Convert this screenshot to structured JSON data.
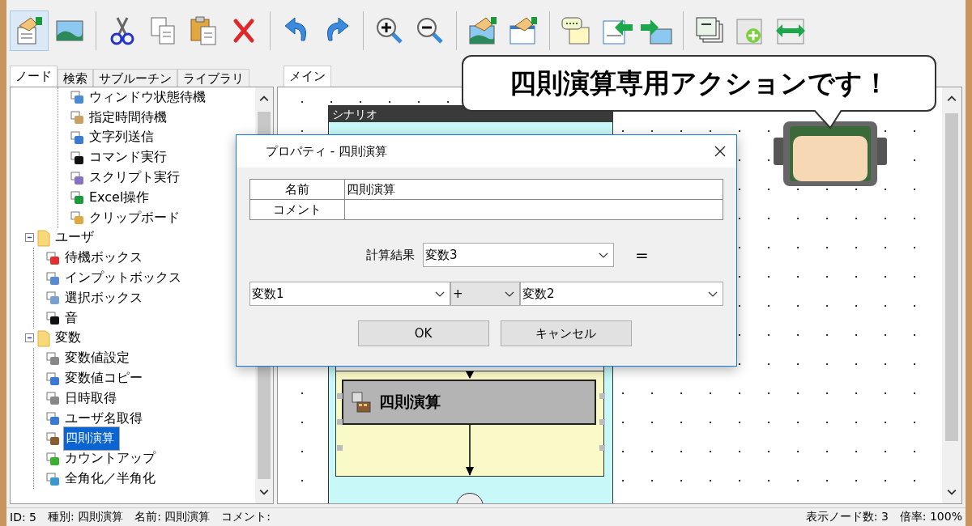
{
  "toolbar": [
    [
      {
        "selected": true
      },
      {
        "selected": false
      }
    ],
    [
      {
        "selected": false
      },
      {
        "selected": false
      },
      {
        "selected": false
      },
      {
        "selected": false
      }
    ],
    [
      {
        "selected": false
      },
      {
        "selected": false
      }
    ],
    [
      {
        "selected": false
      },
      {
        "selected": false
      }
    ],
    [
      {
        "selected": false
      },
      {
        "selected": false
      }
    ],
    [
      {
        "selected": false
      },
      {
        "selected": false
      },
      {
        "selected": false
      }
    ],
    [
      {
        "selected": false
      },
      {
        "selected": false
      },
      {
        "selected": false
      }
    ]
  ],
  "left_tabs": [
    {
      "label": "ノード",
      "selected": true
    },
    {
      "label": "検索",
      "selected": false
    },
    {
      "label": "サブルーチン",
      "selected": false
    },
    {
      "label": "ライブラリ",
      "selected": false
    }
  ],
  "tree": [
    {
      "kind": "hidden",
      "children": [
        {
          "kind": "item",
          "label": "ウィンドウ状態待機",
          "selected": false
        },
        {
          "kind": "item",
          "label": "指定時間待機",
          "selected": false
        },
        {
          "kind": "item",
          "label": "文字列送信",
          "selected": false
        },
        {
          "kind": "item",
          "label": "コマンド実行",
          "selected": false
        },
        {
          "kind": "item",
          "label": "スクリプト実行",
          "selected": false
        },
        {
          "kind": "item",
          "label": "Excel操作",
          "selected": false
        },
        {
          "kind": "item",
          "label": "クリップボード",
          "selected": false
        }
      ]
    },
    {
      "kind": "folder",
      "label": "ユーザ",
      "expanded": true,
      "selected": false,
      "children": [
        {
          "kind": "item",
          "label": "待機ボックス",
          "selected": false
        },
        {
          "kind": "item",
          "label": "インプットボックス",
          "selected": false
        },
        {
          "kind": "item",
          "label": "選択ボックス",
          "selected": false
        },
        {
          "kind": "item",
          "label": "音",
          "selected": false
        }
      ]
    },
    {
      "kind": "folder",
      "label": "変数",
      "expanded": true,
      "selected": false,
      "children": [
        {
          "kind": "item",
          "label": "変数値設定",
          "selected": false
        },
        {
          "kind": "item",
          "label": "変数値コピー",
          "selected": false
        },
        {
          "kind": "item",
          "label": "日時取得",
          "selected": false
        },
        {
          "kind": "item",
          "label": "ユーザ名取得",
          "selected": false
        },
        {
          "kind": "item",
          "label": "四則演算",
          "selected": true
        },
        {
          "kind": "item",
          "label": "カウントアップ",
          "selected": false
        },
        {
          "kind": "item",
          "label": "全角化／半角化",
          "selected": false
        }
      ]
    }
  ],
  "canvas_tabs": [
    {
      "label": "メイン",
      "selected": true
    }
  ],
  "canvas": {
    "scenario_title": "シナリオ",
    "node_label": "四則演算",
    "node_selected": true
  },
  "speech_bubble": {
    "text": "四則演算専用アクションです！"
  },
  "dialog": {
    "title": "プロパティ - 四則演算",
    "properties": [
      {
        "label": "名前",
        "value": "四則演算"
      },
      {
        "label": "コメント"
      }
    ],
    "result_label": "計算結果",
    "result_value": "変数3",
    "equals": "=",
    "operand_1": "変数1",
    "operator": "+",
    "operand_2": "変数2",
    "buttons": [
      "OK",
      "キャンセル"
    ]
  },
  "status_bar": {
    "left": [
      "ID: 5",
      "種別: 四則演算",
      "名前: 四則演算",
      "コメント:"
    ],
    "right": [
      "表示ノード数: 3",
      "倍率: 100%"
    ]
  }
}
